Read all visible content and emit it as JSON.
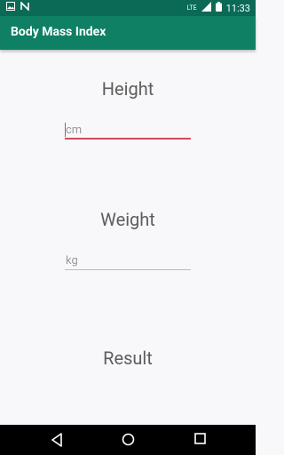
{
  "status_bar": {
    "time": "11:33",
    "network": "LTE",
    "icons": [
      "image-icon",
      "notification-n-icon",
      "signal-icon",
      "battery-icon"
    ]
  },
  "app_bar": {
    "title": "Body Mass Index"
  },
  "main": {
    "height_label": "Height",
    "height_placeholder": "cm",
    "weight_label": "Weight",
    "weight_placeholder": "kg",
    "result_label": "Result"
  },
  "nav_bar": {
    "icons": [
      "back-icon",
      "home-icon",
      "recents-icon"
    ]
  },
  "colors": {
    "status_bar": "#0b6a55",
    "app_bar": "#0f8063",
    "accent": "#d04a5f",
    "background": "#f8f8fb"
  }
}
